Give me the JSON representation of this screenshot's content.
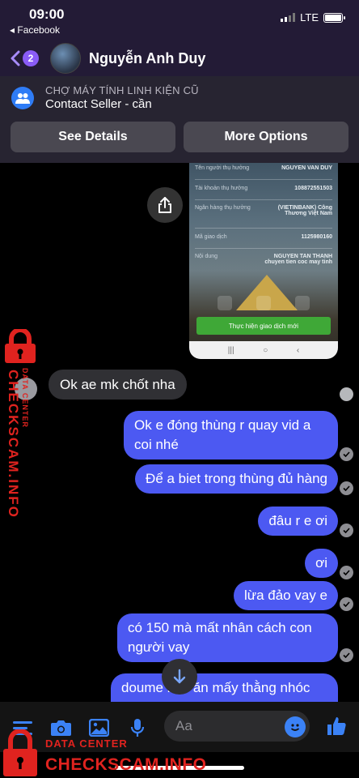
{
  "status_bar": {
    "time": "09:00",
    "back_app": "◂ Facebook",
    "network": "LTE"
  },
  "header": {
    "back_count": "2",
    "contact_name": "Nguyễn Anh Duy"
  },
  "listing": {
    "title": "CHỢ MÁY TÍNH LINH KIỆN CŨ",
    "subtitle": "Contact Seller - cần",
    "see_details": "See Details",
    "more_options": "More Options"
  },
  "receipt_image": {
    "rows": [
      {
        "label": "Tên người thụ hưởng",
        "value": "NGUYEN VAN DUY"
      },
      {
        "label": "Tài khoản thụ hưởng",
        "value": "108872551503"
      },
      {
        "label": "Ngân hàng thụ hưởng",
        "value": "(VIETINBANK) Công Thương Việt Nam"
      },
      {
        "label": "Mã giao dịch",
        "value": "1125980160"
      },
      {
        "label": "Nội dung",
        "value": "NGUYEN TAN THANH chuyen tien coc may tinh"
      }
    ],
    "action_button": "Thực hiện giao dịch mới"
  },
  "messages": {
    "incoming": "Ok ae mk chốt nha",
    "outgoing": [
      "Ok e đóng thùng r quay vid a coi nhé",
      "Để a biet trong thùng đủ hàng",
      "đâu r e ơi",
      "ơi",
      "lừa đảo vay e",
      "có 150 mà mất nhân cách con người vay",
      "doume làm ăn mấy thằng nhóc"
    ]
  },
  "composer": {
    "placeholder": "Aa"
  },
  "watermark": {
    "label_small": "DATA CENTER",
    "label_big": "CHECKSCAM.INFO"
  },
  "colors": {
    "outgoing_bubble": "#4c59f2",
    "incoming_bubble": "#303034",
    "accent_blue": "#2f7cf6",
    "watermark_red": "#e0231f"
  },
  "icons": [
    "back-chevron-icon",
    "group-icon",
    "share-icon",
    "chevron-down-icon",
    "menu-icon",
    "camera-icon",
    "photo-icon",
    "microphone-icon",
    "emoji-icon",
    "thumbs-up-icon",
    "lock-icon"
  ]
}
